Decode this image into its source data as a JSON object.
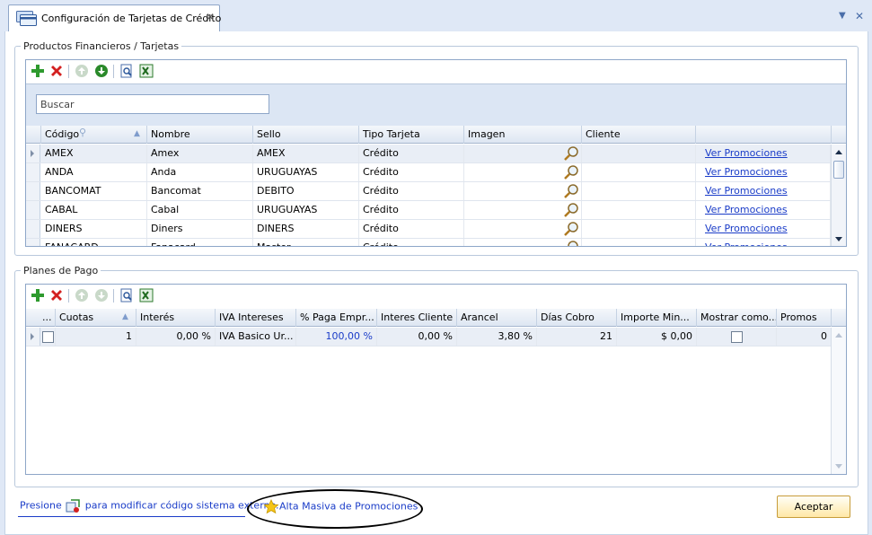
{
  "tab": {
    "title": "Configuración de Tarjetas de Crédito"
  },
  "products": {
    "legend": "Productos Financieros / Tarjetas",
    "search_placeholder": "Buscar",
    "columns": [
      "Código",
      "Nombre",
      "Sello",
      "Tipo Tarjeta",
      "Imagen",
      "Cliente"
    ],
    "rows": [
      {
        "codigo": "AMEX",
        "nombre": "Amex",
        "sello": "AMEX",
        "tipo": "Crédito",
        "link": "Ver Promociones"
      },
      {
        "codigo": "ANDA",
        "nombre": "Anda",
        "sello": "URUGUAYAS",
        "tipo": "Crédito",
        "link": "Ver Promociones"
      },
      {
        "codigo": "BANCOMAT",
        "nombre": "Bancomat",
        "sello": "DEBITO",
        "tipo": "Crédito",
        "link": "Ver Promociones"
      },
      {
        "codigo": "CABAL",
        "nombre": "Cabal",
        "sello": "URUGUAYAS",
        "tipo": "Crédito",
        "link": "Ver Promociones"
      },
      {
        "codigo": "DINERS",
        "nombre": "Diners",
        "sello": "DINERS",
        "tipo": "Crédito",
        "link": "Ver Promociones"
      },
      {
        "codigo": "FANACARD",
        "nombre": "Fanacard",
        "sello": "Master",
        "tipo": "Crédito",
        "link": "Ver Promociones"
      }
    ]
  },
  "plans": {
    "legend": "Planes de Pago",
    "columns": [
      "...",
      "Cuotas",
      "Interés",
      "IVA Intereses",
      "% Paga Empr...",
      "Interes Cliente",
      "Arancel",
      "Días Cobro",
      "Importe Min...",
      "Mostrar como...",
      "Promos"
    ],
    "rows": [
      {
        "cuotas": "1",
        "interes": "0,00 %",
        "iva": "IVA Basico Ur...",
        "paga": "100,00 %",
        "interes_cliente": "0,00 %",
        "arancel": "3,80 %",
        "dias": "21",
        "importe": "$ 0,00",
        "promos": "0"
      }
    ]
  },
  "footer": {
    "hint_prefix": "Presione",
    "hint_suffix": "para modificar código sistema externo.",
    "masiva_label": "Alta Masiva de Promociones",
    "accept_label": "Aceptar"
  },
  "icons": {
    "add": "plus-icon",
    "delete": "delete-icon",
    "up": "up-icon",
    "down": "down-icon",
    "preview": "print-preview-icon",
    "export": "excel-export-icon",
    "image": "magnifier-icon",
    "star": "star-icon"
  },
  "colors": {
    "link": "#1a3cc8",
    "accent": "#dfe8f6"
  }
}
